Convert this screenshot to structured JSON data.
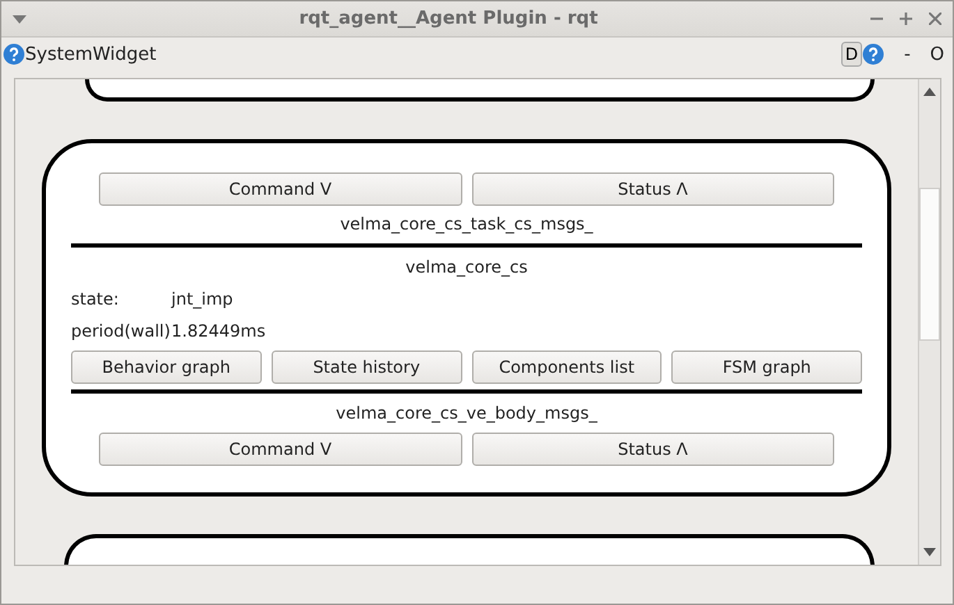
{
  "window": {
    "title": "rqt_agent__Agent Plugin - rqt"
  },
  "toolbar": {
    "title": "SystemWidget",
    "d_button": "D",
    "dash": "-",
    "o_label": "O"
  },
  "card": {
    "items": [
      {
        "kind": "buttons",
        "buttons": [
          "Command V",
          "Status Λ"
        ]
      },
      {
        "kind": "heading",
        "text": "velma_core_cs_task_cs_msgs_"
      },
      {
        "kind": "divider"
      },
      {
        "kind": "heading",
        "text": "velma_core_cs"
      },
      {
        "kind": "field",
        "label": "state:",
        "value": "jnt_imp"
      },
      {
        "kind": "field",
        "label": "period(wall)",
        "value": "1.82449ms"
      },
      {
        "kind": "buttons",
        "buttons": [
          "Behavior graph",
          "State history",
          "Components list",
          "FSM graph"
        ]
      },
      {
        "kind": "divider"
      },
      {
        "kind": "heading",
        "text": "velma_core_cs_ve_body_msgs_"
      },
      {
        "kind": "buttons",
        "buttons": [
          "Command V",
          "Status Λ"
        ]
      }
    ]
  }
}
